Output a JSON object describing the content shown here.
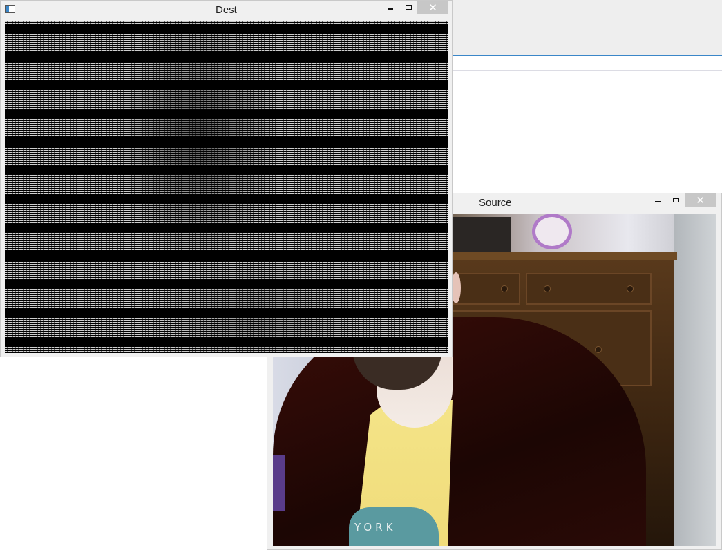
{
  "windows": {
    "dest": {
      "title": "Dest",
      "controls": {
        "minimize": "minimize",
        "maximize": "maximize",
        "close": "close"
      }
    },
    "source": {
      "title": "Source",
      "controls": {
        "minimize": "minimize",
        "maximize": "maximize",
        "close": "close"
      },
      "shirt_text": "YORK"
    }
  },
  "icons": {
    "system_menu": "window-icon",
    "minimize": "minimize-icon",
    "maximize": "maximize-icon",
    "close": "close-icon"
  },
  "colors": {
    "titlebar": "#f0f0f0",
    "close_button": "#c7c7c7",
    "accent_line": "#3a86c8",
    "background_toolbar": "#eeeeee"
  }
}
